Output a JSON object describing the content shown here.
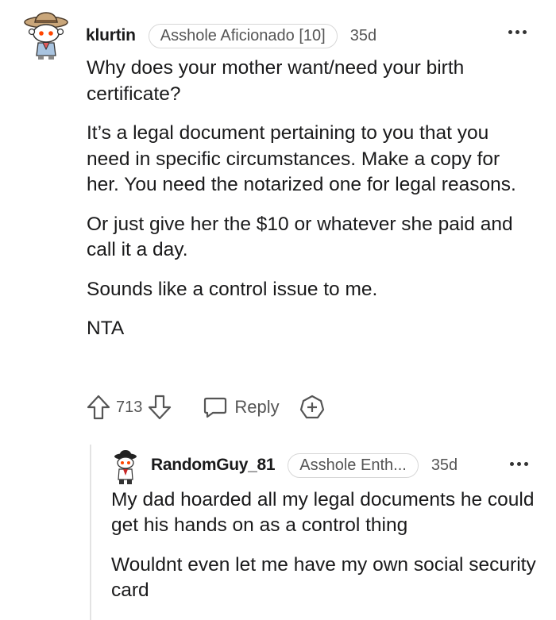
{
  "comment": {
    "username": "klurtin",
    "flair": "Asshole Aficionado [10]",
    "time": "35d",
    "paragraphs": [
      "Why does your mother want/need your birth certificate?",
      "It’s a legal document pertaining to you that you need in specific circumstances. Make a copy for her. You need the notarized one for legal reasons.",
      "Or just give her the $10 or whatever she paid and call it a day.",
      "Sounds like a control issue to me.",
      "NTA"
    ],
    "vote_count": "713",
    "reply_label": "Reply"
  },
  "reply": {
    "username": "RandomGuy_81",
    "flair": "Asshole Enth...",
    "time": "35d",
    "paragraphs": [
      "My dad hoarded all my legal documents he could get his hands on as a control thing",
      "Wouldnt even let me have my own social security card"
    ]
  },
  "colors": {
    "text": "#1a1a1b",
    "meta": "#555555",
    "flair_border": "#d7d7d7",
    "thread_line": "#e3e3e3"
  },
  "icons": [
    "upvote-icon",
    "downvote-icon",
    "reply-bubble-icon",
    "award-plus-icon",
    "more-options-icon"
  ]
}
